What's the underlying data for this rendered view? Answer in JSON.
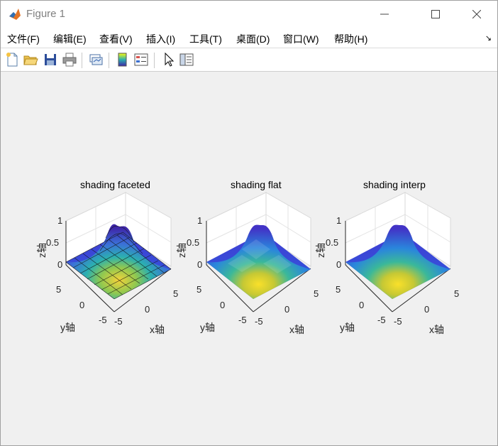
{
  "window": {
    "title": "Figure 1"
  },
  "menubar": {
    "items": [
      "文件(F)",
      "编辑(E)",
      "查看(V)",
      "插入(I)",
      "工具(T)",
      "桌面(D)",
      "窗口(W)",
      "帮助(H)"
    ]
  },
  "toolbar": {
    "icons": [
      "new-figure-icon",
      "open-file-icon",
      "save-icon",
      "print-icon",
      "link-plot-icon",
      "colorbar-icon",
      "legend-icon",
      "pointer-icon",
      "property-editor-icon"
    ]
  },
  "subplots": [
    {
      "title": "shading faceted",
      "xlabel": "x轴",
      "ylabel": "y轴",
      "zlabel": "z轴",
      "zticks": [
        "1",
        "0.5",
        "0"
      ],
      "yticks": [
        "5",
        "0",
        "-5"
      ],
      "xticks": [
        "-5",
        "0",
        "5"
      ]
    },
    {
      "title": "shading flat",
      "xlabel": "x轴",
      "ylabel": "y轴",
      "zlabel": "z轴",
      "zticks": [
        "1",
        "0.5",
        "0"
      ],
      "yticks": [
        "5",
        "0",
        "-5"
      ],
      "xticks": [
        "-5",
        "0",
        "5"
      ]
    },
    {
      "title": "shading interp",
      "xlabel": "x轴",
      "ylabel": "y轴",
      "zlabel": "z轴",
      "zticks": [
        "1",
        "0.5",
        "0"
      ],
      "yticks": [
        "5",
        "0",
        "-5"
      ],
      "xticks": [
        "-5",
        "0",
        "5"
      ]
    }
  ],
  "chart_data": {
    "type": "surface",
    "function": "sinc-like bump",
    "xlim": [
      -5,
      5
    ],
    "ylim": [
      -5,
      5
    ],
    "zlim": [
      0,
      1
    ],
    "colormap": "parula",
    "colors": {
      "low": "#3e26a8",
      "mid": "#2bb0b0",
      "high": "#f9fb0e"
    }
  }
}
